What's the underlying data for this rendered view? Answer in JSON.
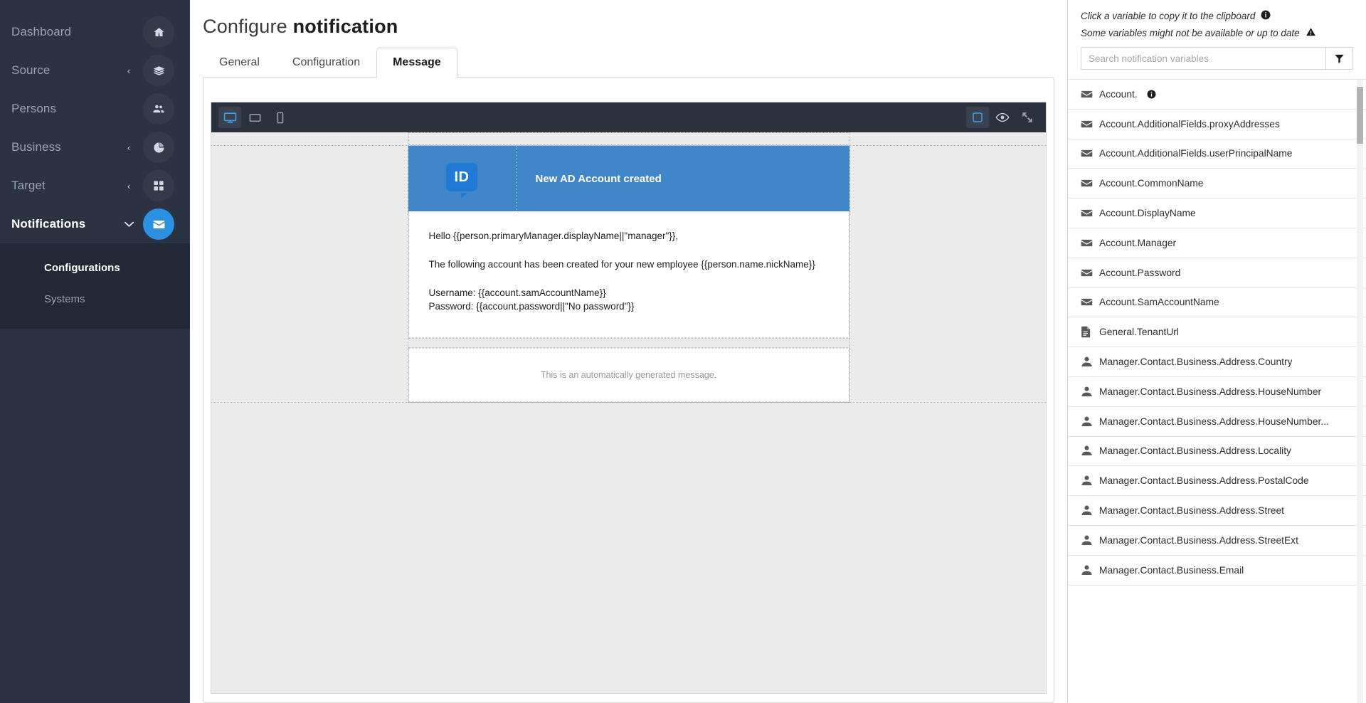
{
  "sidebar": {
    "items": [
      {
        "label": "Dashboard",
        "icon": "home-icon",
        "caret": "",
        "active": false
      },
      {
        "label": "Source",
        "icon": "layers-icon",
        "caret": "‹",
        "active": false
      },
      {
        "label": "Persons",
        "icon": "users-icon",
        "caret": "",
        "active": false
      },
      {
        "label": "Business",
        "icon": "pie-icon",
        "caret": "‹",
        "active": false
      },
      {
        "label": "Target",
        "icon": "grid-icon",
        "caret": "‹",
        "active": false
      },
      {
        "label": "Notifications",
        "icon": "envelope-icon",
        "caret": "∨",
        "active": true
      }
    ],
    "subitems": [
      {
        "label": "Configurations",
        "active": true
      },
      {
        "label": "Systems",
        "active": false
      }
    ],
    "accent": "#2b8fe3"
  },
  "header": {
    "title_prefix": "Configure ",
    "title_bold": "notification"
  },
  "tabs": [
    {
      "label": "General",
      "active": false
    },
    {
      "label": "Configuration",
      "active": false
    },
    {
      "label": "Message",
      "active": true
    }
  ],
  "editor": {
    "toolbar_left": [
      {
        "name": "desktop-view-icon",
        "selected": true
      },
      {
        "name": "tablet-view-icon",
        "selected": false
      },
      {
        "name": "mobile-view-icon",
        "selected": false
      }
    ],
    "toolbar_right": [
      {
        "name": "select-region-icon",
        "selected": true
      },
      {
        "name": "preview-eye-icon",
        "selected": false
      },
      {
        "name": "fullscreen-icon",
        "selected": false
      }
    ],
    "email": {
      "logo_text": "ID",
      "header_title": "New AD Account created",
      "body_lines": [
        "Hello {{person.primaryManager.displayName||\"manager\"}},",
        "The following account has been created for your new employee {{person.name.nickName}}",
        "Username: {{account.samAccountName}}",
        "Password: {{account.password||\"No password\"}}"
      ],
      "footer_text": "This is an automatically generated message.",
      "header_bg": "#3f87c9",
      "logo_bg": "#1f7ad6"
    }
  },
  "variables_panel": {
    "hint_primary": "Click a variable to copy it to the clipboard",
    "hint_secondary": "Some variables might not be available or up to date",
    "search_placeholder": "Search notification variables",
    "search_value": "",
    "filter_label": "filter-icon",
    "items": [
      {
        "label": "Account.",
        "icon": "envelope-icon",
        "info": true
      },
      {
        "label": "Account.AdditionalFields.proxyAddresses",
        "icon": "envelope-icon",
        "info": false
      },
      {
        "label": "Account.AdditionalFields.userPrincipalName",
        "icon": "envelope-icon",
        "info": false
      },
      {
        "label": "Account.CommonName",
        "icon": "envelope-icon",
        "info": false
      },
      {
        "label": "Account.DisplayName",
        "icon": "envelope-icon",
        "info": false
      },
      {
        "label": "Account.Manager",
        "icon": "envelope-icon",
        "info": false
      },
      {
        "label": "Account.Password",
        "icon": "envelope-icon",
        "info": false
      },
      {
        "label": "Account.SamAccountName",
        "icon": "envelope-icon",
        "info": false
      },
      {
        "label": "General.TenantUrl",
        "icon": "document-icon",
        "info": false
      },
      {
        "label": "Manager.Contact.Business.Address.Country",
        "icon": "person-icon",
        "info": false
      },
      {
        "label": "Manager.Contact.Business.Address.HouseNumber",
        "icon": "person-icon",
        "info": false
      },
      {
        "label": "Manager.Contact.Business.Address.HouseNumber...",
        "icon": "person-icon",
        "info": false
      },
      {
        "label": "Manager.Contact.Business.Address.Locality",
        "icon": "person-icon",
        "info": false
      },
      {
        "label": "Manager.Contact.Business.Address.PostalCode",
        "icon": "person-icon",
        "info": false
      },
      {
        "label": "Manager.Contact.Business.Address.Street",
        "icon": "person-icon",
        "info": false
      },
      {
        "label": "Manager.Contact.Business.Address.StreetExt",
        "icon": "person-icon",
        "info": false
      },
      {
        "label": "Manager.Contact.Business.Email",
        "icon": "person-icon",
        "info": false
      }
    ]
  }
}
